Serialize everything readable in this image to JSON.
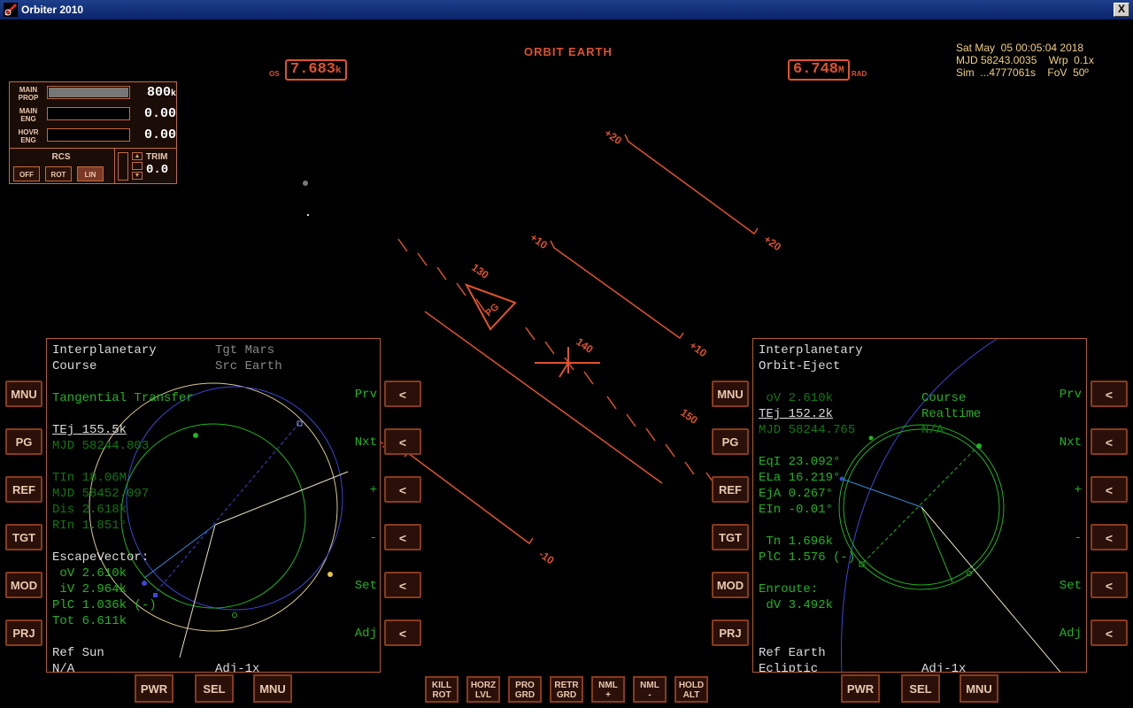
{
  "window": {
    "title": "Orbiter 2010",
    "close": "X"
  },
  "hud": {
    "mode": "ORBIT EARTH",
    "os_label": "OS",
    "os_value": "7.683",
    "os_unit": "k",
    "rad_value": "6.748",
    "rad_unit": "M",
    "rad_label": "RAD",
    "ladder": [
      "+20",
      "+20",
      "+10",
      "+10",
      "-10",
      "-10",
      "130",
      "140",
      "150",
      "PG"
    ]
  },
  "info": {
    "line1": "Sat May  05 00:05:04 2018",
    "line2": "MJD 58243.0035    Wrp  0.1x",
    "line3": "Sim  ...4777061s    FoV  50º"
  },
  "engines": {
    "main_prop_label": "MAIN PROP",
    "main_prop_value": "800",
    "main_prop_unit": "k",
    "main_prop_level": 1.0,
    "main_eng_label": "MAIN ENG",
    "main_eng_value": "0.00",
    "hovr_eng_label": "HOVR ENG",
    "hovr_eng_value": "0.00",
    "rcs_label": "RCS",
    "rcs_off": "OFF",
    "rcs_rot": "ROT",
    "rcs_lin": "LIN",
    "trim_label": "TRIM",
    "trim_value": "0.0"
  },
  "mfd_left": {
    "title1": "Interplanetary",
    "title2": "Course",
    "tgt": "Tgt Mars",
    "src": "Src Earth",
    "mode": "Tangential Transfer",
    "tej": "TEj 155.5k",
    "mjd1": "MJD 58244.803",
    "tin": "TIn 18.06M",
    "mjd2": "MJD 58452.097",
    "dis": "Dis 2.618k",
    "rin": "RIn 1.851°",
    "esc": "EscapeVector:",
    "ov": " oV 2.610k",
    "iv": " iV 2.964k",
    "plc": "PlC 1.036k (-)",
    "tot": "Tot 6.611k",
    "ref": "Ref Sun",
    "na": "N/A",
    "adj": "Adj-1x"
  },
  "mfd_right": {
    "title1": "Interplanetary",
    "title2": "Orbit-Eject",
    "ov": " oV 2.610k",
    "course": "Course",
    "realtime": "Realtime",
    "tej": "TEj 152.2k",
    "mjd": "MJD 58244.765",
    "na": "N/A",
    "eqi": "EqI 23.092°",
    "ela": "ELa 16.219°",
    "eja": "EjA 0.267°",
    "ein": "EIn -0.01°",
    "tn": " Tn 1.696k",
    "plc": "PlC 1.576 (-)",
    "enroute": "Enroute:",
    "dv": " dV 3.492k",
    "ref": "Ref Earth",
    "ecl": "Ecliptic",
    "adj": "Adj-1x"
  },
  "side_left": [
    "MNU",
    "PG",
    "REF",
    "TGT",
    "MOD",
    "PRJ"
  ],
  "side_right_labels": [
    "Prv",
    "Nxt",
    "+",
    "-",
    "Set",
    "Adj"
  ],
  "arrow": "<",
  "bottom_left": [
    "PWR",
    "SEL",
    "MNU"
  ],
  "bottom_right": [
    "PWR",
    "SEL",
    "MNU"
  ],
  "autopilot": [
    {
      "l1": "KILL",
      "l2": "ROT"
    },
    {
      "l1": "HORZ",
      "l2": "LVL"
    },
    {
      "l1": "PRO",
      "l2": "GRD"
    },
    {
      "l1": "RETR",
      "l2": "GRD"
    },
    {
      "l1": "NML",
      "l2": "+"
    },
    {
      "l1": "NML",
      "l2": "-"
    },
    {
      "l1": "HOLD",
      "l2": "ALT"
    }
  ],
  "colors": {
    "hud": "#e0522a",
    "mfd_text": "#1fb61f",
    "mfd_white": "#dcdcdc",
    "info": "#f0d080"
  }
}
